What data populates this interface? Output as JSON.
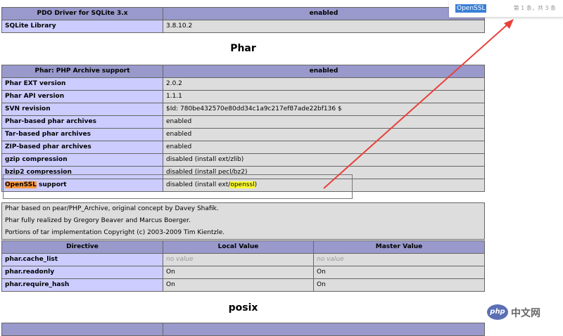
{
  "pdo_table": {
    "header": [
      "PDO Driver for SQLite 3.x",
      "enabled"
    ],
    "rows": [
      [
        "SQLite Library",
        "3.8.10.2"
      ]
    ]
  },
  "phar_section": {
    "title": "Phar",
    "support_header": [
      "Phar: PHP Archive support",
      "enabled"
    ],
    "rows": [
      [
        "Phar EXT version",
        "2.0.2"
      ],
      [
        "Phar API version",
        "1.1.1"
      ],
      [
        "SVN revision",
        "$Id: 780be432570e80dd34c1a9c217ef87ade22bf136 $"
      ],
      [
        "Phar-based phar archives",
        "enabled"
      ],
      [
        "Tar-based phar archives",
        "enabled"
      ],
      [
        "ZIP-based phar archives",
        "enabled"
      ],
      [
        "gzip compression",
        "disabled (install ext/zlib)"
      ],
      [
        "bzip2 compression",
        "disabled (install pecl/bz2)"
      ]
    ],
    "openssl_row": {
      "label_hl": "OpenSSL",
      "label_rest": " support",
      "value_pre": "disabled (install ext/",
      "value_hl": "openssl",
      "value_post": ")"
    },
    "notes": [
      "Phar based on pear/PHP_Archive, original concept by Davey Shafik.",
      "Phar fully realized by Gregory Beaver and Marcus Boerger.",
      "Portions of tar implementation Copyright (c) 2003-2009 Tim Kientzle."
    ],
    "directives": {
      "headers": [
        "Directive",
        "Local Value",
        "Master Value"
      ],
      "rows": [
        [
          "phar.cache_list",
          "no value",
          "no value"
        ],
        [
          "phar.readonly",
          "On",
          "On"
        ],
        [
          "phar.require_hash",
          "On",
          "On"
        ]
      ]
    }
  },
  "posix_section": {
    "title": "posix"
  },
  "find_bar": {
    "term": "OpenSSL",
    "count": "第 1 条，共 3 条"
  },
  "watermark": {
    "logo": "php",
    "text": "中文网"
  },
  "colors": {
    "header": "#9999cc",
    "label": "#ccccff",
    "value": "#dddddd",
    "arrow": "#e8413b"
  }
}
